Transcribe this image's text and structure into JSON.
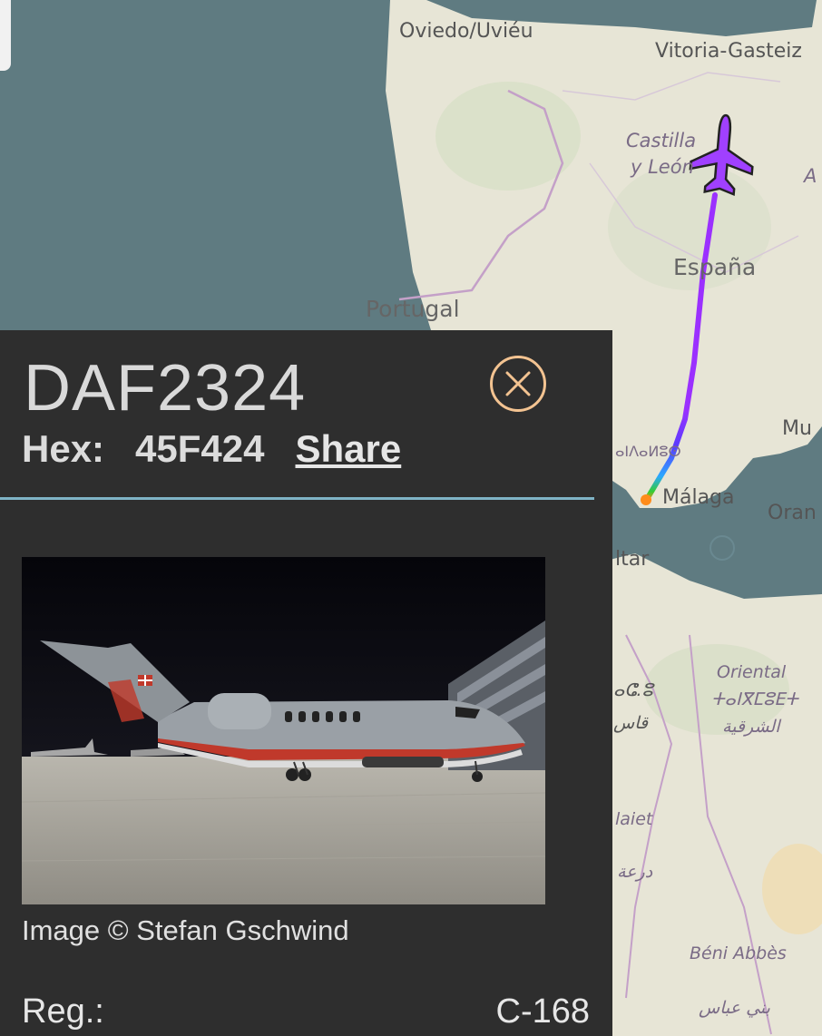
{
  "map": {
    "labels": [
      {
        "text": "Oviedo/Uviéu",
        "cls": ""
      },
      {
        "text": "Vitoria-Gasteiz",
        "cls": ""
      },
      {
        "text": "Castilla",
        "cls": "italic"
      },
      {
        "text": "y León",
        "cls": "italic"
      },
      {
        "text": "España",
        "cls": "big"
      },
      {
        "text": "Portugal",
        "cls": "big"
      },
      {
        "text": "Málaga",
        "cls": ""
      },
      {
        "text": "Oran",
        "cls": ""
      },
      {
        "text": "Mu",
        "cls": ""
      },
      {
        "text": "ltar",
        "cls": ""
      },
      {
        "text": "Oriental",
        "cls": "sm"
      },
      {
        "text": "ⵜⴰⵏⴳⵎⵓⴹⵜ",
        "cls": "sm"
      },
      {
        "text": "الشرقية",
        "cls": "sm"
      },
      {
        "text": "Béni Abbès",
        "cls": "sm"
      },
      {
        "text": "بني عباس",
        "cls": "sm"
      },
      {
        "text": "ⴰⵏⴷⴰⵍⵓⵙ",
        "cls": ""
      },
      {
        "text": "A",
        "cls": "italic"
      },
      {
        "text": "ⴰⵛ.ⵓ",
        "cls": "sm"
      },
      {
        "text": "قاس",
        "cls": "sm"
      },
      {
        "text": "laiet",
        "cls": "sm"
      },
      {
        "text": "درعة",
        "cls": "sm"
      }
    ],
    "track_color": "#9b30ff",
    "aircraft_icon": "plane-icon"
  },
  "panel": {
    "callsign": "DAF2324",
    "hex_label": "Hex:",
    "hex_value": "45F424",
    "share_label": "Share",
    "photo_credit": "Image © Stefan Gschwind",
    "reg_label": "Reg.:",
    "reg_value": "C-168",
    "close_icon": "close-icon",
    "accent_color": "#f3c391",
    "divider_color": "#7fb4c6"
  }
}
